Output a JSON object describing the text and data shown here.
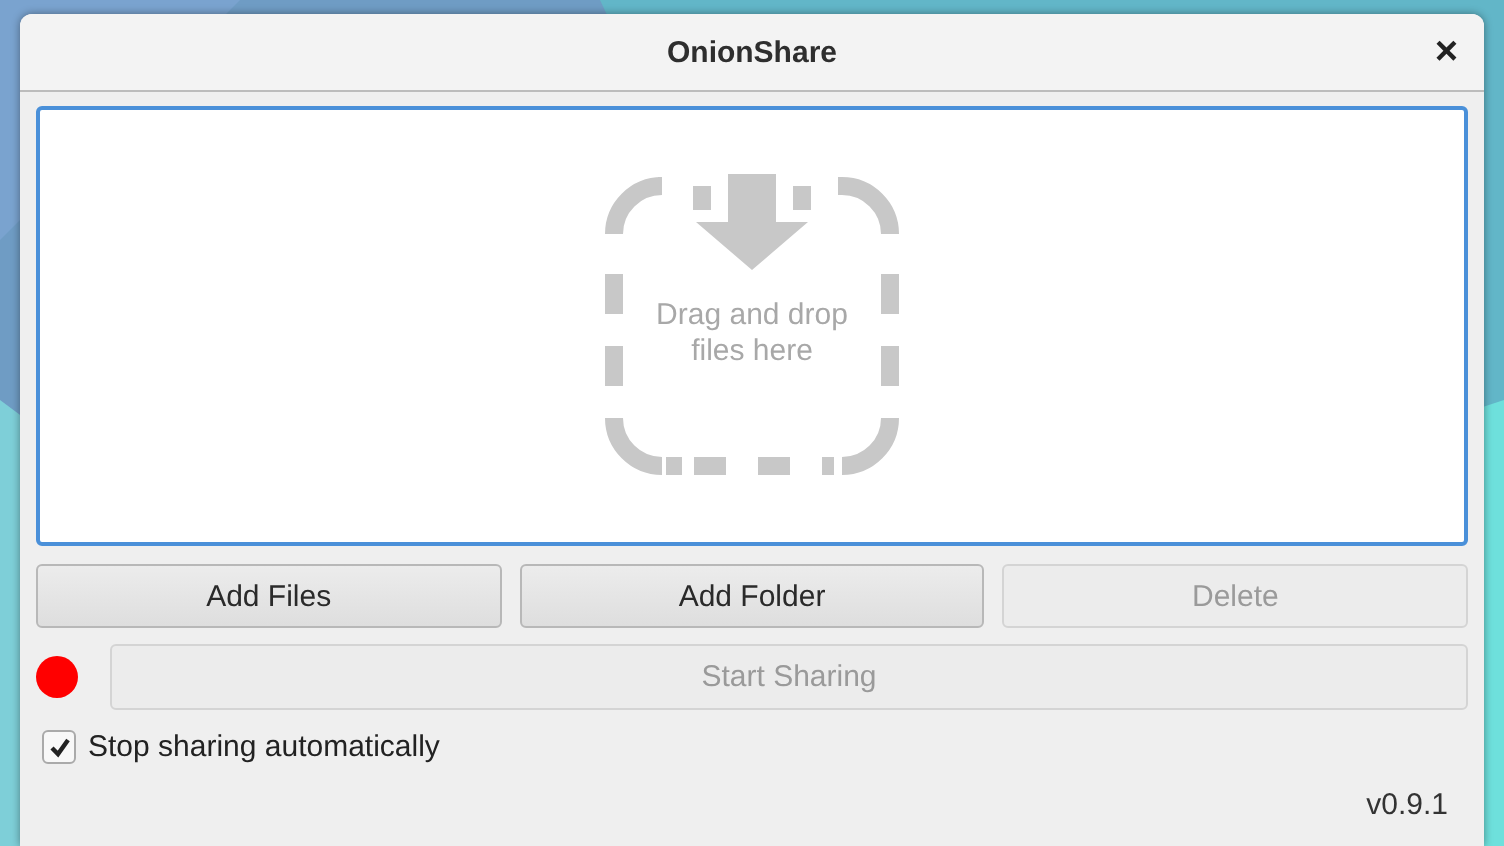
{
  "window": {
    "title": "OnionShare",
    "close": "×"
  },
  "drop_zone": {
    "hint": "Drag and drop\nfiles here"
  },
  "file_buttons": [
    {
      "label": "Add Files",
      "disabled": false
    },
    {
      "label": "Add Folder",
      "disabled": false
    },
    {
      "label": "Delete",
      "disabled": true
    }
  ],
  "server_status": {
    "color": "#ff0000"
  },
  "start_button": {
    "label": "Start Sharing",
    "disabled": true
  },
  "stop_automatically": {
    "label": "Stop sharing automatically",
    "checked": true
  },
  "version": "v0.9.1"
}
